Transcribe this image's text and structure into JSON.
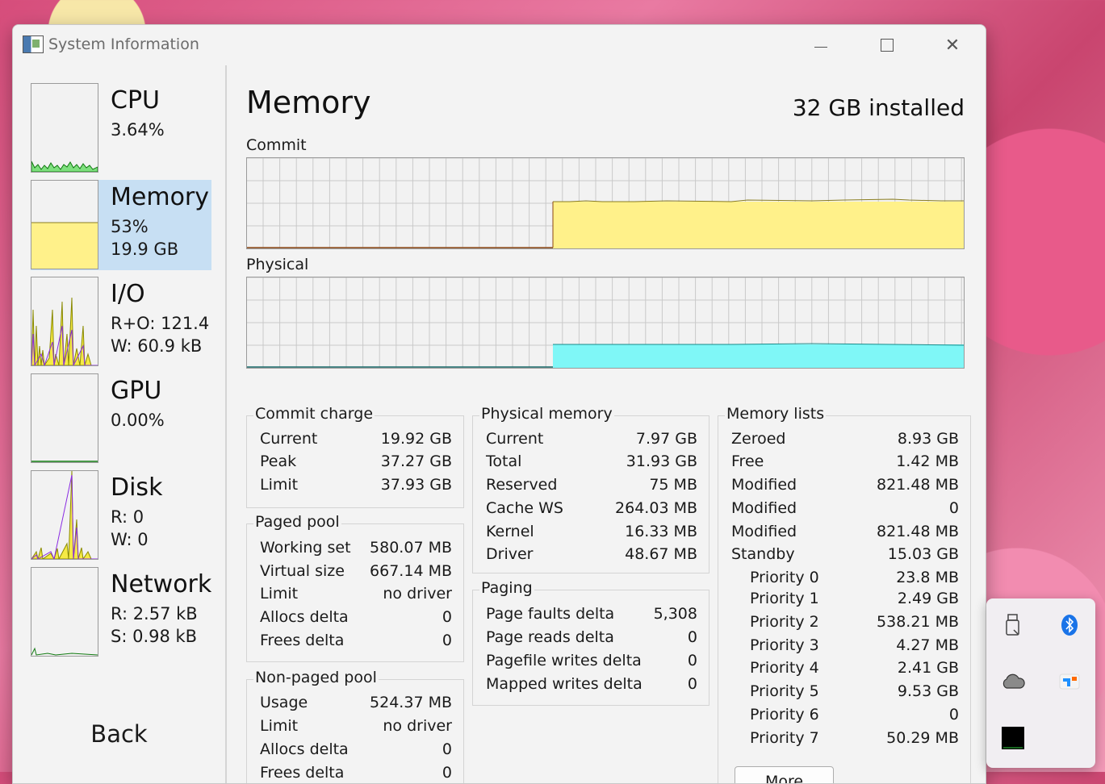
{
  "window": {
    "title": "System Information"
  },
  "sidebar": {
    "items": [
      {
        "name": "CPU",
        "line1": "3.64%",
        "line2": ""
      },
      {
        "name": "Memory",
        "line1": "53%",
        "line2": "19.9 GB"
      },
      {
        "name": "I/O",
        "line1": "R+O: 121.4",
        "line2": "W: 60.9 kB"
      },
      {
        "name": "GPU",
        "line1": "0.00%",
        "line2": ""
      },
      {
        "name": "Disk",
        "line1": "R: 0",
        "line2": "W: 0"
      },
      {
        "name": "Network",
        "line1": "R: 2.57 kB",
        "line2": "S: 0.98 kB"
      }
    ],
    "back_label": "Back"
  },
  "main": {
    "title": "Memory",
    "installed": "32 GB installed",
    "commit_label": "Commit",
    "physical_label": "Physical",
    "commit_charge": {
      "title": "Commit charge",
      "rows": [
        {
          "k": "Current",
          "v": "19.92 GB"
        },
        {
          "k": "Peak",
          "v": "37.27 GB"
        },
        {
          "k": "Limit",
          "v": "37.93 GB"
        }
      ]
    },
    "paged_pool": {
      "title": "Paged pool",
      "rows": [
        {
          "k": "Working set",
          "v": "580.07 MB"
        },
        {
          "k": "Virtual size",
          "v": "667.14 MB"
        },
        {
          "k": "Limit",
          "v": "no driver"
        },
        {
          "k": "Allocs delta",
          "v": "0"
        },
        {
          "k": "Frees delta",
          "v": "0"
        }
      ]
    },
    "non_paged_pool": {
      "title": "Non-paged pool",
      "rows": [
        {
          "k": "Usage",
          "v": "524.37 MB"
        },
        {
          "k": "Limit",
          "v": "no driver"
        },
        {
          "k": "Allocs delta",
          "v": "0"
        },
        {
          "k": "Frees delta",
          "v": "0"
        }
      ]
    },
    "physical_memory": {
      "title": "Physical memory",
      "rows": [
        {
          "k": "Current",
          "v": "7.97 GB"
        },
        {
          "k": "Total",
          "v": "31.93 GB"
        },
        {
          "k": "Reserved",
          "v": "75 MB"
        },
        {
          "k": "Cache WS",
          "v": "264.03 MB"
        },
        {
          "k": "Kernel",
          "v": "16.33 MB"
        },
        {
          "k": "Driver",
          "v": "48.67 MB"
        }
      ]
    },
    "paging": {
      "title": "Paging",
      "rows": [
        {
          "k": "Page faults delta",
          "v": "5,308"
        },
        {
          "k": "Page reads delta",
          "v": "0"
        },
        {
          "k": "Pagefile writes delta",
          "v": "0"
        },
        {
          "k": "Mapped writes delta",
          "v": "0"
        }
      ]
    },
    "memory_lists": {
      "title": "Memory lists",
      "rows": [
        {
          "k": "Zeroed",
          "v": "8.93 GB"
        },
        {
          "k": "Free",
          "v": "1.42 MB"
        },
        {
          "k": "Modified",
          "v": "821.48 MB"
        },
        {
          "k": "Modified",
          "v": "0"
        },
        {
          "k": "Modified",
          "v": "821.48 MB"
        },
        {
          "k": "Standby",
          "v": "15.03 GB"
        },
        {
          "k": "Priority 0",
          "v": "23.8 MB"
        },
        {
          "k": "Priority 1",
          "v": "2.49 GB"
        },
        {
          "k": "Priority 2",
          "v": "538.21 MB"
        },
        {
          "k": "Priority 3",
          "v": "4.27 MB"
        },
        {
          "k": "Priority 4",
          "v": "2.41 GB"
        },
        {
          "k": "Priority 5",
          "v": "9.53 GB"
        },
        {
          "k": "Priority 6",
          "v": "0"
        },
        {
          "k": "Priority 7",
          "v": "50.29 MB"
        }
      ],
      "more_label": "More"
    }
  },
  "tray": {
    "icons": [
      "usb-drive-icon",
      "bluetooth-icon",
      "onedrive-cloud-icon",
      "app-tray-icon",
      "system-info-tray-icon"
    ]
  },
  "colors": {
    "selected": "#c7dff3",
    "commit_fill": "#fff18a",
    "physical_fill": "#7ff7f7",
    "grid": "#c9c9c9"
  }
}
